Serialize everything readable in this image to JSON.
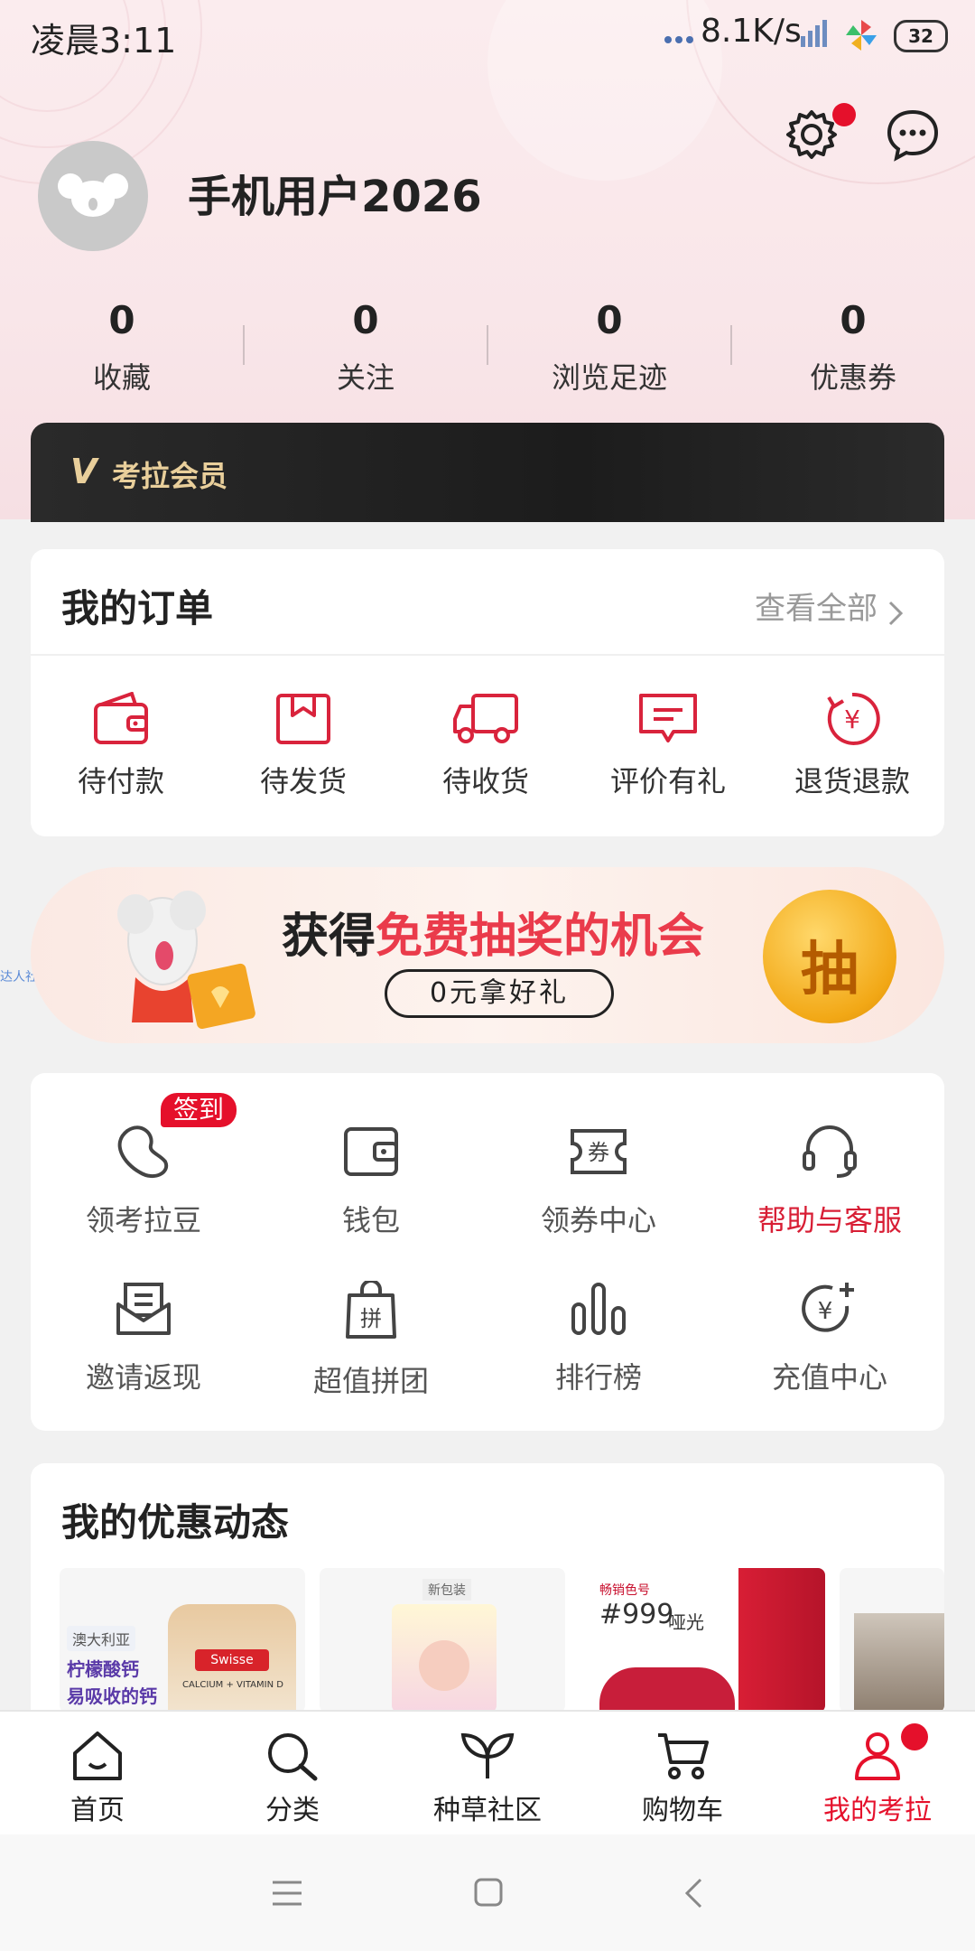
{
  "status_bar": {
    "time": "凌晨3:11",
    "network_speed": "8.1K/s",
    "battery": "32"
  },
  "profile": {
    "username": "手机用户2026"
  },
  "stats": [
    {
      "value": "0",
      "label": "收藏"
    },
    {
      "value": "0",
      "label": "关注"
    },
    {
      "value": "0",
      "label": "浏览足迹"
    },
    {
      "value": "0",
      "label": "优惠券"
    }
  ],
  "vip": {
    "label": "考拉会员",
    "badge": "V"
  },
  "orders": {
    "title": "我的订单",
    "see_all": "查看全部",
    "items": [
      {
        "label": "待付款",
        "icon": "wallet-icon"
      },
      {
        "label": "待发货",
        "icon": "package-icon"
      },
      {
        "label": "待收货",
        "icon": "truck-icon"
      },
      {
        "label": "评价有礼",
        "icon": "comment-icon"
      },
      {
        "label": "退货退款",
        "icon": "refund-icon"
      }
    ]
  },
  "banner": {
    "title_normal": "获得",
    "title_highlight": "免费抽奖的机会",
    "subtitle": "0元拿好礼",
    "coin_text": "抽",
    "side_tag": "达人社区"
  },
  "services": {
    "sign_badge": "签到",
    "items": [
      {
        "label": "领考拉豆",
        "icon": "bean-icon"
      },
      {
        "label": "钱包",
        "icon": "wallet-icon"
      },
      {
        "label": "领券中心",
        "icon": "coupon-icon"
      },
      {
        "label": "帮助与客服",
        "icon": "headset-icon"
      },
      {
        "label": "邀请返现",
        "icon": "invite-icon"
      },
      {
        "label": "超值拼团",
        "icon": "group-buy-icon"
      },
      {
        "label": "排行榜",
        "icon": "ranking-icon"
      },
      {
        "label": "充值中心",
        "icon": "recharge-icon"
      }
    ]
  },
  "promo": {
    "title": "我的优惠动态",
    "products": [
      {
        "tag": "澳大利亚",
        "line1": "柠檬酸钙",
        "line2": "易吸收的钙",
        "brand": "Swisse",
        "sub": "CALCIUM + VITAMIN D"
      },
      {
        "tag": "新包装"
      },
      {
        "tag": "畅销色号",
        "line1": "#999",
        "line2": "哑光"
      },
      {
        "tag": ""
      }
    ]
  },
  "colors": {
    "accent": "#e5102b",
    "red_text": "#d81e35",
    "icon_red": "#d9233c"
  },
  "bottom_nav": [
    {
      "label": "首页",
      "icon": "home-icon"
    },
    {
      "label": "分类",
      "icon": "search-icon"
    },
    {
      "label": "种草社区",
      "icon": "sprout-icon"
    },
    {
      "label": "购物车",
      "icon": "cart-icon"
    },
    {
      "label": "我的考拉",
      "icon": "user-icon"
    }
  ]
}
